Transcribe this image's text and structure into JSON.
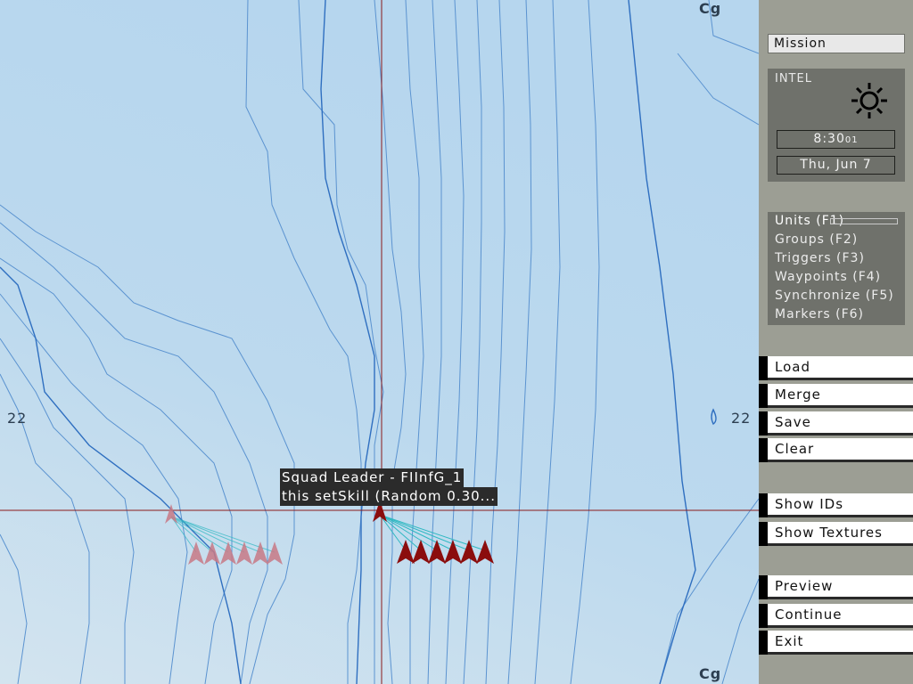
{
  "map": {
    "grid_labels": {
      "left": "22",
      "right": "22",
      "top": "Cg",
      "bottom": "Cg"
    },
    "tooltip": {
      "title": "Squad Leader - FIInfG_1",
      "init": "this setSkill (Random 0.30..."
    },
    "colors": {
      "water": "#b9d8ee",
      "contour": "#3f7cc4",
      "crosshair": "#8b1a1a",
      "unit_active": "#8b0d0d",
      "unit_ghost": "#c87a86",
      "link": "#2fb8c2"
    }
  },
  "sidebar": {
    "mission_tab": "Mission",
    "intel": {
      "title": "INTEL",
      "weather_icon": "sun-icon",
      "time": "8:30",
      "seconds": "01",
      "date": "Thu, Jun 7"
    },
    "modes": [
      {
        "label": "Units (F1)",
        "active": true
      },
      {
        "label": "Groups (F2)",
        "active": false
      },
      {
        "label": "Triggers (F3)",
        "active": false
      },
      {
        "label": "Waypoints (F4)",
        "active": false
      },
      {
        "label": "Synchronize (F5)",
        "active": false
      },
      {
        "label": "Markers (F6)",
        "active": false
      }
    ],
    "file_buttons": [
      "Load",
      "Merge",
      "Save",
      "Clear"
    ],
    "view_buttons": [
      "Show IDs",
      "Show Textures"
    ],
    "run_buttons": [
      "Preview",
      "Continue",
      "Exit"
    ]
  }
}
